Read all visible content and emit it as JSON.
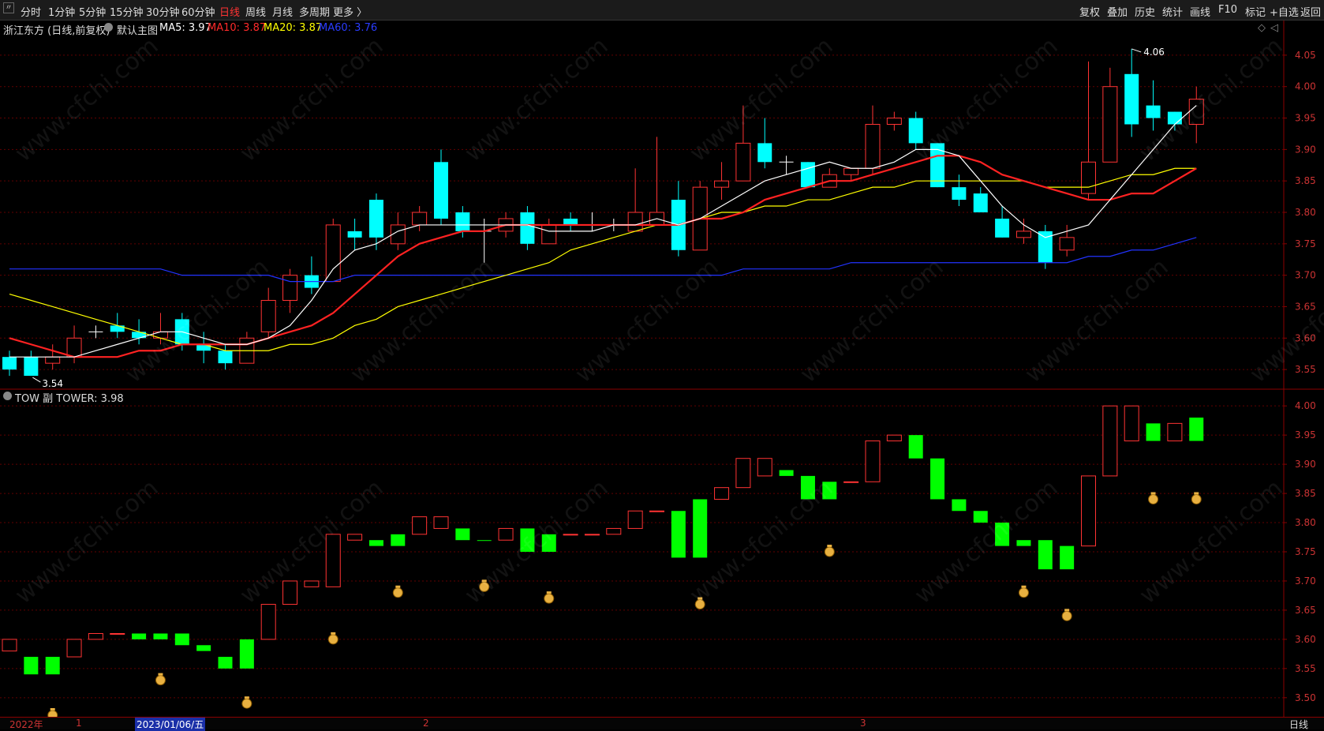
{
  "toolbar": {
    "back_icon": "back-icon",
    "periods": [
      "分时",
      "1分钟",
      "5分钟",
      "15分钟",
      "30分钟",
      "60分钟",
      "日线",
      "周线",
      "月线",
      "多周期",
      "更多 〉"
    ],
    "active_period": "日线",
    "right_items": [
      "复权",
      "叠加",
      "历史",
      "统计",
      "画线",
      "F10",
      "标记",
      "+自选",
      "返回"
    ]
  },
  "main_panel": {
    "stock_label": "浙江东方 (日线,前复权)",
    "indicator_name": "默认主图",
    "ma": [
      {
        "label": "MA5: 3.97",
        "color": "#ffffff"
      },
      {
        "label": "MA10: 3.87",
        "color": "#ff2a2a"
      },
      {
        "label": "MA20: 3.87",
        "color": "#ffff00"
      },
      {
        "label": "MA60: 3.76",
        "color": "#2a3cff"
      }
    ],
    "high_marker": "4.06",
    "low_marker": "3.54"
  },
  "sub_panel": {
    "label": "TOW 副 TOWER: 3.98"
  },
  "footer": {
    "date_labels": [
      "2022年",
      "1",
      "2023/01/06/五",
      "2",
      "3"
    ],
    "period": "日线"
  },
  "colors": {
    "up": "#ff3333",
    "down": "#00ffff",
    "tower_up": "#ff3333",
    "tower_down": "#00ff00",
    "grid": "#8b0000",
    "ma5": "#ffffff",
    "ma10": "#ff2222",
    "ma20": "#ffff00",
    "ma60": "#2233ff"
  },
  "chart_data": {
    "type": "candlestick",
    "y_axis_main": {
      "range": [
        3.52,
        4.08
      ],
      "ticks": [
        "4.05",
        "4.00",
        "3.95",
        "3.90",
        "3.85",
        "3.80",
        "3.75",
        "3.70",
        "3.65",
        "3.60",
        "3.55"
      ]
    },
    "y_axis_sub": {
      "range": [
        3.47,
        4.03
      ],
      "ticks": [
        "4.00",
        "3.95",
        "3.90",
        "3.85",
        "3.80",
        "3.75",
        "3.70",
        "3.65",
        "3.60",
        "3.55",
        "3.50"
      ]
    },
    "candles": [
      [
        3.57,
        3.55,
        3.58,
        3.54
      ],
      [
        3.57,
        3.54,
        3.58,
        3.54
      ],
      [
        3.56,
        3.57,
        3.59,
        3.55
      ],
      [
        3.57,
        3.6,
        3.62,
        3.56
      ],
      [
        3.61,
        3.61,
        3.62,
        3.6
      ],
      [
        3.62,
        3.61,
        3.64,
        3.6
      ],
      [
        3.61,
        3.6,
        3.63,
        3.59
      ],
      [
        3.6,
        3.61,
        3.64,
        3.59
      ],
      [
        3.63,
        3.59,
        3.64,
        3.58
      ],
      [
        3.59,
        3.58,
        3.61,
        3.56
      ],
      [
        3.58,
        3.56,
        3.59,
        3.55
      ],
      [
        3.56,
        3.6,
        3.61,
        3.56
      ],
      [
        3.61,
        3.66,
        3.68,
        3.6
      ],
      [
        3.66,
        3.7,
        3.71,
        3.64
      ],
      [
        3.7,
        3.68,
        3.73,
        3.67
      ],
      [
        3.69,
        3.78,
        3.79,
        3.69
      ],
      [
        3.77,
        3.76,
        3.79,
        3.74
      ],
      [
        3.82,
        3.76,
        3.83,
        3.74
      ],
      [
        3.75,
        3.78,
        3.8,
        3.74
      ],
      [
        3.78,
        3.8,
        3.81,
        3.77
      ],
      [
        3.88,
        3.79,
        3.9,
        3.78
      ],
      [
        3.8,
        3.77,
        3.81,
        3.76
      ],
      [
        3.77,
        3.77,
        3.79,
        3.72
      ],
      [
        3.77,
        3.79,
        3.8,
        3.76
      ],
      [
        3.8,
        3.75,
        3.81,
        3.74
      ],
      [
        3.75,
        3.78,
        3.79,
        3.75
      ],
      [
        3.79,
        3.78,
        3.8,
        3.77
      ],
      [
        3.78,
        3.78,
        3.8,
        3.77
      ],
      [
        3.78,
        3.78,
        3.79,
        3.77
      ],
      [
        3.77,
        3.8,
        3.87,
        3.77
      ],
      [
        3.78,
        3.8,
        3.92,
        3.78
      ],
      [
        3.82,
        3.74,
        3.85,
        3.73
      ],
      [
        3.74,
        3.84,
        3.85,
        3.75
      ],
      [
        3.84,
        3.85,
        3.88,
        3.82
      ],
      [
        3.85,
        3.91,
        3.97,
        3.85
      ],
      [
        3.91,
        3.88,
        3.95,
        3.87
      ],
      [
        3.88,
        3.88,
        3.89,
        3.86
      ],
      [
        3.88,
        3.84,
        3.88,
        3.84
      ],
      [
        3.84,
        3.86,
        3.87,
        3.84
      ],
      [
        3.86,
        3.87,
        3.87,
        3.85
      ],
      [
        3.87,
        3.94,
        3.97,
        3.86
      ],
      [
        3.94,
        3.95,
        3.96,
        3.93
      ],
      [
        3.95,
        3.91,
        3.96,
        3.9
      ],
      [
        3.91,
        3.84,
        3.91,
        3.84
      ],
      [
        3.84,
        3.82,
        3.86,
        3.81
      ],
      [
        3.83,
        3.8,
        3.84,
        3.8
      ],
      [
        3.79,
        3.76,
        3.81,
        3.76
      ],
      [
        3.76,
        3.77,
        3.79,
        3.75
      ],
      [
        3.77,
        3.72,
        3.78,
        3.71
      ],
      [
        3.74,
        3.76,
        3.78,
        3.73
      ],
      [
        3.83,
        3.88,
        4.04,
        3.82
      ],
      [
        3.88,
        4.0,
        4.03,
        3.88
      ],
      [
        4.02,
        3.94,
        4.06,
        3.92
      ],
      [
        3.97,
        3.95,
        4.01,
        3.93
      ],
      [
        3.96,
        3.94,
        3.96,
        3.93
      ],
      [
        3.94,
        3.98,
        4.0,
        3.91
      ]
    ],
    "ma5": [
      3.57,
      3.57,
      3.57,
      3.57,
      3.58,
      3.59,
      3.6,
      3.61,
      3.61,
      3.6,
      3.59,
      3.59,
      3.6,
      3.62,
      3.66,
      3.71,
      3.74,
      3.75,
      3.77,
      3.78,
      3.78,
      3.78,
      3.78,
      3.78,
      3.78,
      3.77,
      3.77,
      3.77,
      3.78,
      3.78,
      3.79,
      3.78,
      3.79,
      3.81,
      3.83,
      3.85,
      3.86,
      3.87,
      3.88,
      3.87,
      3.87,
      3.88,
      3.9,
      3.9,
      3.89,
      3.85,
      3.81,
      3.78,
      3.76,
      3.77,
      3.78,
      3.82,
      3.86,
      3.9,
      3.94,
      3.97
    ],
    "ma10": [
      3.6,
      3.59,
      3.58,
      3.57,
      3.57,
      3.57,
      3.58,
      3.58,
      3.59,
      3.59,
      3.59,
      3.59,
      3.6,
      3.61,
      3.62,
      3.64,
      3.67,
      3.7,
      3.73,
      3.75,
      3.76,
      3.77,
      3.77,
      3.78,
      3.78,
      3.78,
      3.78,
      3.78,
      3.78,
      3.78,
      3.78,
      3.78,
      3.79,
      3.79,
      3.8,
      3.82,
      3.83,
      3.84,
      3.85,
      3.85,
      3.86,
      3.87,
      3.88,
      3.89,
      3.89,
      3.88,
      3.86,
      3.85,
      3.84,
      3.83,
      3.82,
      3.82,
      3.83,
      3.83,
      3.85,
      3.87
    ],
    "ma20": [
      3.67,
      3.66,
      3.65,
      3.64,
      3.63,
      3.62,
      3.61,
      3.6,
      3.59,
      3.59,
      3.58,
      3.58,
      3.58,
      3.59,
      3.59,
      3.6,
      3.62,
      3.63,
      3.65,
      3.66,
      3.67,
      3.68,
      3.69,
      3.7,
      3.71,
      3.72,
      3.74,
      3.75,
      3.76,
      3.77,
      3.78,
      3.78,
      3.79,
      3.8,
      3.8,
      3.81,
      3.81,
      3.82,
      3.82,
      3.83,
      3.84,
      3.84,
      3.85,
      3.85,
      3.85,
      3.85,
      3.85,
      3.85,
      3.84,
      3.84,
      3.84,
      3.85,
      3.86,
      3.86,
      3.87,
      3.87
    ],
    "ma60": [
      3.71,
      3.71,
      3.71,
      3.71,
      3.71,
      3.71,
      3.71,
      3.71,
      3.7,
      3.7,
      3.7,
      3.7,
      3.7,
      3.69,
      3.69,
      3.69,
      3.7,
      3.7,
      3.7,
      3.7,
      3.7,
      3.7,
      3.7,
      3.7,
      3.7,
      3.7,
      3.7,
      3.7,
      3.7,
      3.7,
      3.7,
      3.7,
      3.7,
      3.7,
      3.71,
      3.71,
      3.71,
      3.71,
      3.71,
      3.72,
      3.72,
      3.72,
      3.72,
      3.72,
      3.72,
      3.72,
      3.72,
      3.72,
      3.72,
      3.72,
      3.73,
      3.73,
      3.74,
      3.74,
      3.75,
      3.76
    ],
    "tower": [
      [
        3.58,
        3.6,
        "up"
      ],
      [
        3.54,
        3.57,
        "down"
      ],
      [
        3.54,
        3.57,
        "down"
      ],
      [
        3.57,
        3.6,
        "up"
      ],
      [
        3.6,
        3.61,
        "up"
      ],
      [
        3.61,
        3.61,
        "up"
      ],
      [
        3.6,
        3.61,
        "down"
      ],
      [
        3.6,
        3.61,
        "down"
      ],
      [
        3.59,
        3.61,
        "down"
      ],
      [
        3.58,
        3.59,
        "down"
      ],
      [
        3.55,
        3.57,
        "down"
      ],
      [
        3.55,
        3.6,
        "down"
      ],
      [
        3.6,
        3.66,
        "up"
      ],
      [
        3.66,
        3.7,
        "up"
      ],
      [
        3.69,
        3.7,
        "up"
      ],
      [
        3.69,
        3.78,
        "up"
      ],
      [
        3.77,
        3.78,
        "up"
      ],
      [
        3.76,
        3.77,
        "down"
      ],
      [
        3.76,
        3.78,
        "down"
      ],
      [
        3.78,
        3.81,
        "up"
      ],
      [
        3.79,
        3.81,
        "up"
      ],
      [
        3.77,
        3.79,
        "down"
      ],
      [
        3.77,
        3.77,
        "down"
      ],
      [
        3.77,
        3.79,
        "up"
      ],
      [
        3.75,
        3.79,
        "down"
      ],
      [
        3.75,
        3.78,
        "down"
      ],
      [
        3.78,
        3.78,
        "up"
      ],
      [
        3.78,
        3.78,
        "up"
      ],
      [
        3.78,
        3.79,
        "up"
      ],
      [
        3.79,
        3.82,
        "up"
      ],
      [
        3.82,
        3.82,
        "up"
      ],
      [
        3.74,
        3.82,
        "down"
      ],
      [
        3.74,
        3.84,
        "down"
      ],
      [
        3.84,
        3.86,
        "up"
      ],
      [
        3.86,
        3.91,
        "up"
      ],
      [
        3.88,
        3.91,
        "up"
      ],
      [
        3.88,
        3.89,
        "down"
      ],
      [
        3.84,
        3.88,
        "down"
      ],
      [
        3.84,
        3.87,
        "down"
      ],
      [
        3.87,
        3.87,
        "up"
      ],
      [
        3.87,
        3.94,
        "up"
      ],
      [
        3.94,
        3.95,
        "up"
      ],
      [
        3.91,
        3.95,
        "down"
      ],
      [
        3.84,
        3.91,
        "down"
      ],
      [
        3.82,
        3.84,
        "down"
      ],
      [
        3.8,
        3.82,
        "down"
      ],
      [
        3.76,
        3.8,
        "down"
      ],
      [
        3.76,
        3.77,
        "down"
      ],
      [
        3.72,
        3.77,
        "down"
      ],
      [
        3.72,
        3.76,
        "down"
      ],
      [
        3.76,
        3.88,
        "up"
      ],
      [
        3.88,
        4.0,
        "up"
      ],
      [
        3.94,
        4.0,
        "up"
      ],
      [
        3.94,
        3.97,
        "down"
      ],
      [
        3.94,
        3.97,
        "up"
      ],
      [
        3.94,
        3.98,
        "down"
      ]
    ],
    "money_bags_sub": [
      [
        2,
        3.47
      ],
      [
        7,
        3.53
      ],
      [
        11,
        3.49
      ],
      [
        15,
        3.6
      ],
      [
        18,
        3.68
      ],
      [
        22,
        3.69
      ],
      [
        25,
        3.67
      ],
      [
        32,
        3.66
      ],
      [
        38,
        3.75
      ],
      [
        47,
        3.68
      ],
      [
        49,
        3.64
      ],
      [
        53,
        3.84
      ],
      [
        55,
        3.84
      ]
    ]
  }
}
